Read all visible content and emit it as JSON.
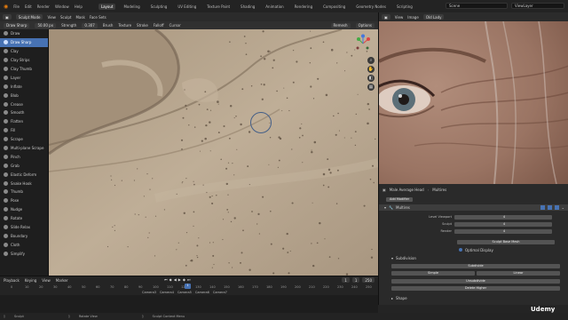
{
  "topbar": {
    "menus": [
      "File",
      "Edit",
      "Render",
      "Window",
      "Help"
    ],
    "workspaces": [
      "Layout",
      "Modeling",
      "Sculpting",
      "UV Editing",
      "Texture Paint",
      "Shading",
      "Animation",
      "Rendering",
      "Compositing",
      "Geometry Nodes",
      "Scripting"
    ],
    "active_workspace": "Layout",
    "scene_label": "Scene",
    "viewlayer_label": "ViewLayer"
  },
  "viewport_header": {
    "mode": "Sculpt Mode",
    "menus": [
      "View",
      "Sculpt",
      "Mask",
      "Face Sets"
    ],
    "brush_name": "Draw Sharp",
    "radius_value": "50.00 px",
    "strength_label": "Strength",
    "strength_value": "0.307",
    "menus2": [
      "Brush",
      "Texture",
      "Stroke",
      "Falloff",
      "Cursor"
    ]
  },
  "sub_header": {
    "remesh": "Remesh",
    "options": "Options"
  },
  "tools": [
    {
      "label": "Draw",
      "active": false
    },
    {
      "label": "Draw Sharp",
      "active": true
    },
    {
      "label": "Clay",
      "active": false
    },
    {
      "label": "Clay Strips",
      "active": false
    },
    {
      "label": "Clay Thumb",
      "active": false
    },
    {
      "label": "Layer",
      "active": false
    },
    {
      "label": "Inflate",
      "active": false
    },
    {
      "label": "Blob",
      "active": false
    },
    {
      "label": "Crease",
      "active": false
    },
    {
      "label": "Smooth",
      "active": false
    },
    {
      "label": "Flatten",
      "active": false
    },
    {
      "label": "Fill",
      "active": false
    },
    {
      "label": "Scrape",
      "active": false
    },
    {
      "label": "Multi-plane Scrape",
      "active": false
    },
    {
      "label": "Pinch",
      "active": false
    },
    {
      "label": "Grab",
      "active": false
    },
    {
      "label": "Elastic Deform",
      "active": false
    },
    {
      "label": "Snake Hook",
      "active": false
    },
    {
      "label": "Thumb",
      "active": false
    },
    {
      "label": "Pose",
      "active": false
    },
    {
      "label": "Nudge",
      "active": false
    },
    {
      "label": "Rotate",
      "active": false
    },
    {
      "label": "Slide Relax",
      "active": false
    },
    {
      "label": "Boundary",
      "active": false
    },
    {
      "label": "Cloth",
      "active": false
    },
    {
      "label": "Simplify",
      "active": false
    }
  ],
  "image_editor": {
    "menus": [
      "View",
      "Image"
    ],
    "image_name": "Old Lady",
    "photo_colors": {
      "skin": "#a88270",
      "skin_dark": "#6e4a3c",
      "iris": "#5c6f78"
    }
  },
  "properties": {
    "object_name": "Male Average Head",
    "modifier_tab": "Multires",
    "add_modifier": "Add Modifier",
    "modifier_name": "Multires",
    "rows": [
      {
        "label": "Level Viewport",
        "value": "4"
      },
      {
        "label": "Sculpt",
        "value": "4"
      },
      {
        "label": "Render",
        "value": "4"
      }
    ],
    "sculpt_base_mesh": "Sculpt Base Mesh",
    "optimal_display": "Optimal Display",
    "subdivision_section": "Subdivision",
    "subdivide": "Subdivide",
    "simple": "Simple",
    "linear": "Linear",
    "unsubdivide": "Unsubdivide",
    "delete_higher": "Delete Higher",
    "shape_section": "Shape"
  },
  "timeline": {
    "menus": [
      "Playback",
      "Keying",
      "View",
      "Marker"
    ],
    "current_frame": "1",
    "ticks": [
      "0",
      "10",
      "20",
      "30",
      "40",
      "50",
      "60",
      "70",
      "80",
      "90",
      "100",
      "110",
      "120",
      "130",
      "140",
      "150",
      "160",
      "170",
      "180",
      "190",
      "200",
      "210",
      "220",
      "230",
      "240",
      "250"
    ],
    "markers": [
      "Camera3",
      "Camera4",
      "Camera5",
      "Camera6",
      "Camera7"
    ],
    "start": "1",
    "end": "250"
  },
  "statusbar": {
    "items": [
      "Sculpt",
      "Rotate View",
      "Sculpt Context Menu"
    ]
  },
  "watermark": "Udemy",
  "colors": {
    "accent": "#4772b3",
    "clay": "#b7a690",
    "clay_shadow": "#7a6a58",
    "blue_icon": "#3b7cd6"
  }
}
